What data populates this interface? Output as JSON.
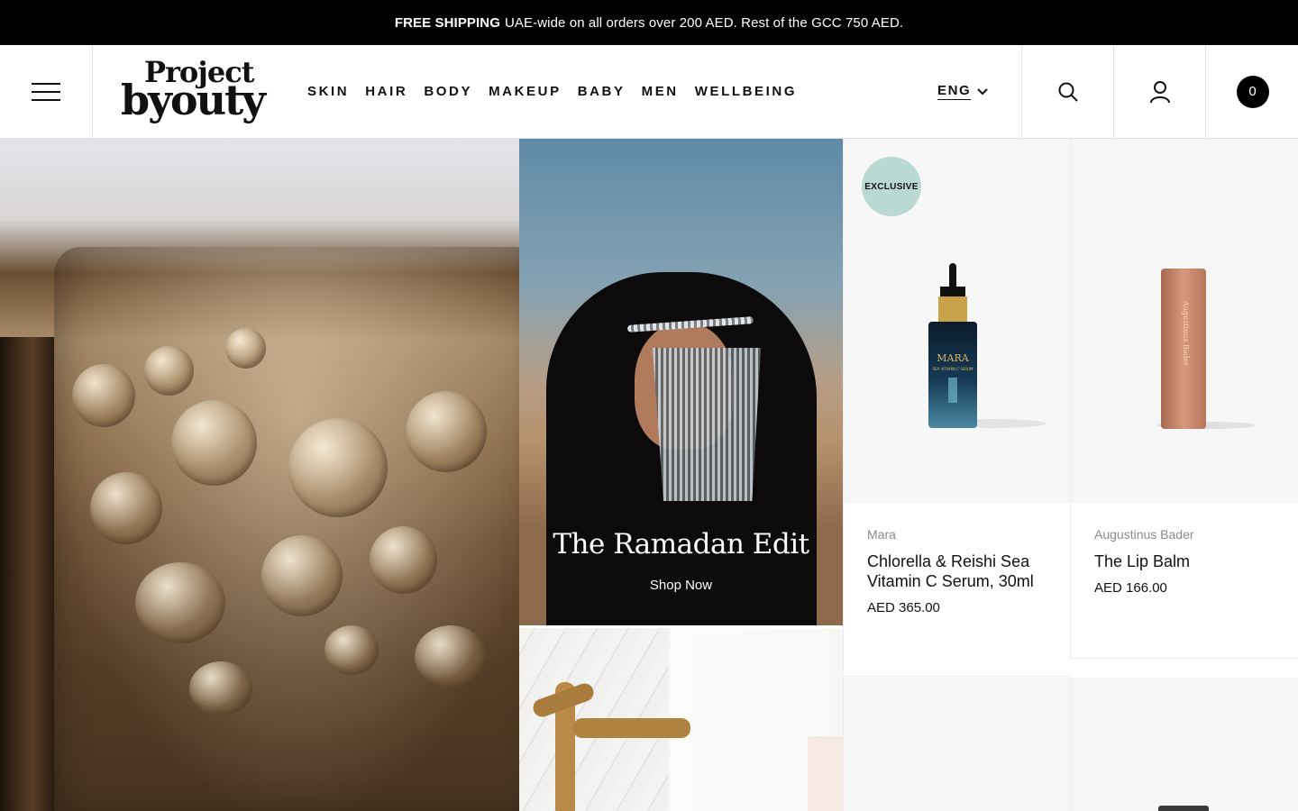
{
  "announcement": {
    "bold": "FREE SHIPPING",
    "text": "UAE-wide on all orders over 200 AED. Rest of the GCC 750 AED."
  },
  "header": {
    "logo_line1": "Project",
    "logo_line2": "byouty",
    "nav": [
      "SKIN",
      "HAIR",
      "BODY",
      "MAKEUP",
      "BABY",
      "MEN",
      "WELLBEING"
    ],
    "language": "ENG",
    "cart_count": "0"
  },
  "hero": {
    "title": "The Ramadan Edit",
    "cta": "Shop Now"
  },
  "products": [
    {
      "badge": "EXCLUSIVE",
      "brand": "Mara",
      "name": "Chlorella & Reishi Sea Vitamin C Serum, 30ml",
      "price": "AED 365.00",
      "label_text": "MARA",
      "label_sub": "SEA VITAMIN C SERUM"
    },
    {
      "brand": "Augustinus Bader",
      "name": "The Lip Balm",
      "price": "AED 166.00",
      "label_text": "Augustinus Bader"
    }
  ],
  "icons": {
    "menu": "hamburger-icon",
    "search": "search-icon",
    "account": "user-icon",
    "chevron": "chevron-down-icon"
  },
  "colors": {
    "topbar": "#000000",
    "badge": "#b9d9d2",
    "cart": "#000000"
  }
}
